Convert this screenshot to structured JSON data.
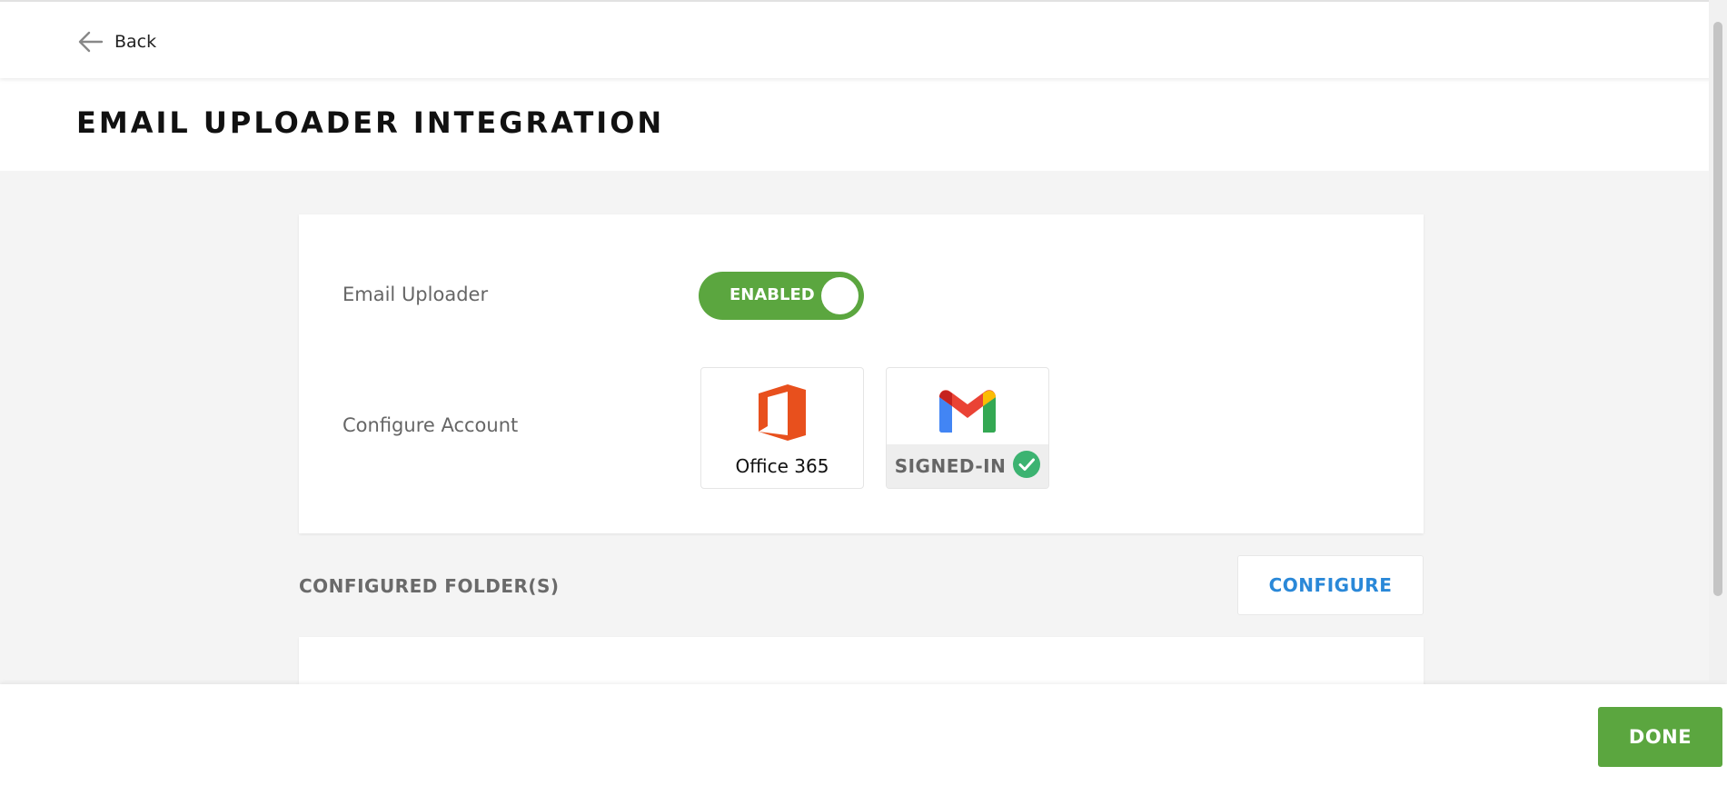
{
  "header": {
    "back_label": "Back",
    "back_icon": "arrow-left-icon"
  },
  "page": {
    "title": "EMAIL UPLOADER INTEGRATION"
  },
  "settings": {
    "email_uploader_label": "Email Uploader",
    "toggle_state_label": "ENABLED",
    "toggle_enabled": true,
    "configure_account_label": "Configure Account",
    "providers": [
      {
        "name": "Office 365",
        "icon": "office-365-icon"
      },
      {
        "name": "Gmail",
        "icon": "gmail-icon",
        "status_label": "SIGNED-IN",
        "status_icon": "check-circle-icon"
      }
    ]
  },
  "folders": {
    "heading": "CONFIGURED FOLDER(S)",
    "configure_label": "CONFIGURE"
  },
  "footer": {
    "done_label": "DONE"
  },
  "colors": {
    "accent_green": "#5ba63f",
    "link_blue": "#2a88d8",
    "check_green": "#3cb371",
    "office_orange": "#e8501d"
  }
}
